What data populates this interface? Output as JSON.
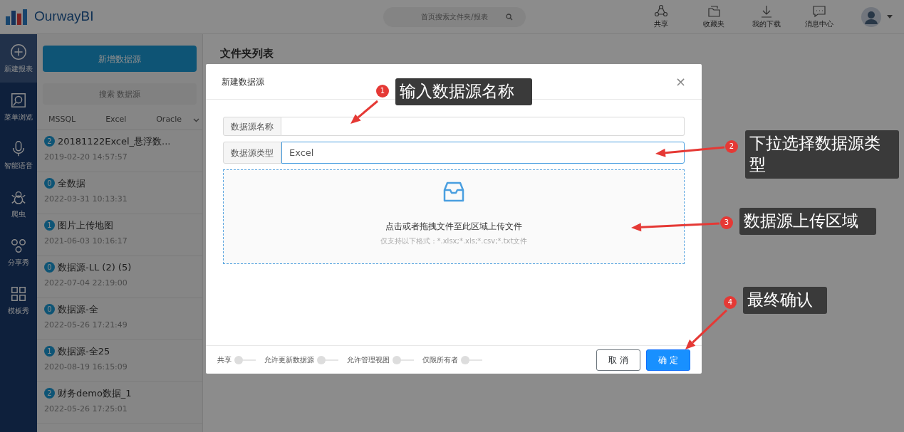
{
  "app": {
    "logo": "OurwayBI",
    "search": {
      "placeholder": "首页搜索文件夹/报表"
    },
    "toolbar": [
      {
        "label": "共享",
        "kind": "share"
      },
      {
        "label": "收藏夹",
        "kind": "folder"
      },
      {
        "label": "我的下载",
        "kind": "download"
      },
      {
        "label": "消息中心",
        "kind": "message"
      }
    ]
  },
  "nav": [
    {
      "label": "新建报表",
      "kind": "plus",
      "selected": true
    },
    {
      "label": "菜单浏览",
      "kind": "browse",
      "selected": false
    },
    {
      "label": "智能语音",
      "kind": "mic",
      "selected": false
    },
    {
      "label": "爬虫",
      "kind": "bug",
      "selected": false
    },
    {
      "label": "分享秀",
      "kind": "share",
      "selected": false
    },
    {
      "label": "模板秀",
      "kind": "grid",
      "selected": false
    }
  ],
  "sources": {
    "new_button": "新增数据源",
    "search": {
      "placeholder": "搜索 数据源"
    },
    "filters": [
      "MSSQL",
      "Excel",
      "Oracle"
    ],
    "items": [
      {
        "count": "2",
        "name": "20181122Excel_悬浮数...",
        "time": "2019-02-20 14:57:57"
      },
      {
        "count": "0",
        "name": "全数据",
        "time": "2022-03-31 10:13:31"
      },
      {
        "count": "1",
        "name": "图片上传地图",
        "time": "2021-06-03 10:16:17"
      },
      {
        "count": "0",
        "name": "数据源-LL (2) (5)",
        "time": "2022-07-04 22:19:00"
      },
      {
        "count": "0",
        "name": "数据源-全",
        "time": "2022-05-26 17:21:49"
      },
      {
        "count": "1",
        "name": "数据源-全25",
        "time": "2020-08-19 16:15:09"
      },
      {
        "count": "2",
        "name": "财务demo数据_1",
        "time": "2022-05-26 17:25:01"
      }
    ]
  },
  "main": {
    "heading": "文件夹列表"
  },
  "dialog": {
    "title": "新建数据源",
    "close": "×",
    "fields": [
      {
        "label": "数据源名称",
        "focused": false
      },
      {
        "label": "数据源类型",
        "value": "Excel",
        "focused": true
      }
    ],
    "upload": {
      "title": "点击或者拖拽文件至此区域上传文件",
      "hint": "仅支持以下格式：*.xlsx;*.xls;*.csv;*.txt文件"
    },
    "toggles": [
      {
        "label": "共享",
        "on": false
      },
      {
        "label": "允许更新数据源",
        "on": false
      },
      {
        "label": "允许管理视图",
        "on": false
      },
      {
        "label": "仅限所有者",
        "on": false
      }
    ],
    "buttons": [
      {
        "label": "取 消",
        "kind": "secondary"
      },
      {
        "label": "确 定",
        "kind": "primary"
      }
    ]
  },
  "annotations": [
    {
      "number": "1",
      "text": "输入数据源名称"
    },
    {
      "number": "2",
      "text": "下拉选择数据源类型"
    },
    {
      "number": "3",
      "text": "数据源上传区域"
    },
    {
      "number": "4",
      "text": "最终确认"
    }
  ]
}
